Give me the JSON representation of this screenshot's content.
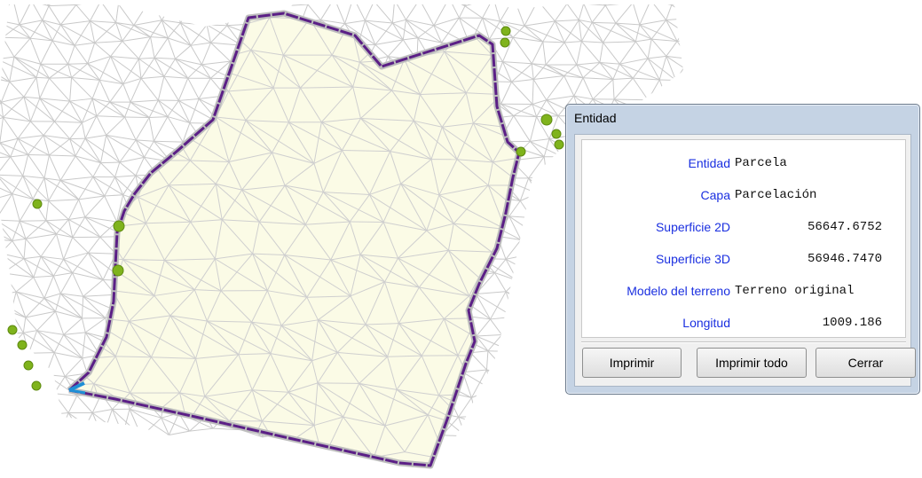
{
  "dialog": {
    "title": "Entidad",
    "properties": [
      {
        "label": "Entidad",
        "value": "Parcela",
        "align": "left"
      },
      {
        "label": "Capa",
        "value": "Parcelación",
        "align": "left"
      },
      {
        "label": "Superficie 2D",
        "value": "56647.6752",
        "align": "right"
      },
      {
        "label": "Superficie 3D",
        "value": "56946.7470",
        "align": "right"
      },
      {
        "label": "Modelo del terreno",
        "value": "Terreno original",
        "align": "left"
      },
      {
        "label": "Longitud",
        "value": "1009.186",
        "align": "right"
      }
    ],
    "buttons": {
      "print": "Imprimir",
      "print_all": "Imprimir todo",
      "close": "Cerrar"
    }
  },
  "colors": {
    "parcel_fill": "#fbfbe6",
    "parcel_outline": "#5b1f86",
    "mesh": "#c9c9c9",
    "vertex_marker": "#7fb31c",
    "selected_segment": "#1e8fd6",
    "label_text": "#1a2fe0"
  }
}
